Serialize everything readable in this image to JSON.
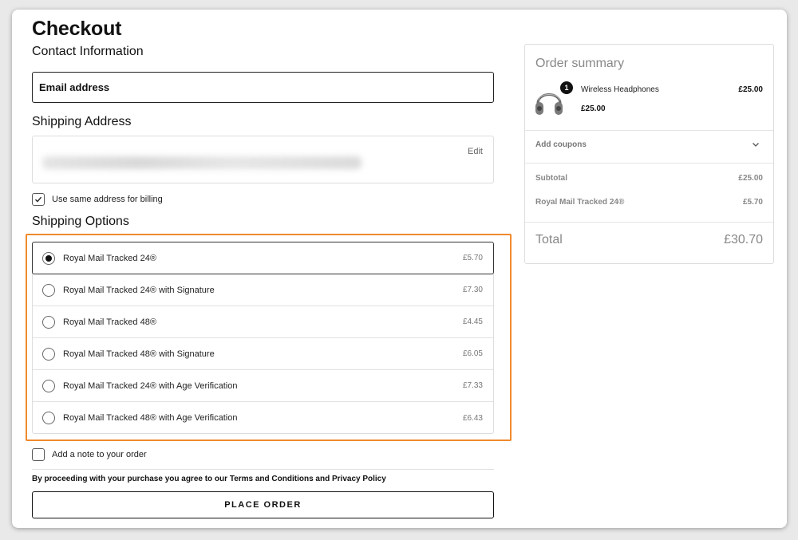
{
  "checkout": {
    "title": "Checkout",
    "contact_heading": "Contact Information",
    "email_placeholder": "Email address",
    "shipping_address_heading": "Shipping Address",
    "edit_label": "Edit",
    "same_billing_label": "Use same address for billing",
    "same_billing_checked": true,
    "shipping_options_heading": "Shipping Options",
    "shipping_options": [
      {
        "label": "Royal Mail Tracked 24®",
        "price": "£5.70",
        "selected": true
      },
      {
        "label": "Royal Mail Tracked 24® with Signature",
        "price": "£7.30",
        "selected": false
      },
      {
        "label": "Royal Mail Tracked 48®",
        "price": "£4.45",
        "selected": false
      },
      {
        "label": "Royal Mail Tracked 48® with Signature",
        "price": "£6.05",
        "selected": false
      },
      {
        "label": "Royal Mail Tracked 24® with Age Verification",
        "price": "£7.33",
        "selected": false
      },
      {
        "label": "Royal Mail Tracked 48® with Age Verification",
        "price": "£6.43",
        "selected": false
      }
    ],
    "note_label": "Add a note to your order",
    "note_checked": false,
    "terms_text": "By proceeding with your purchase you agree to our Terms and Conditions and Privacy Policy",
    "place_order_label": "PLACE ORDER"
  },
  "summary": {
    "title": "Order summary",
    "item": {
      "name": "Wireless Headphones",
      "quantity": "1",
      "unit_price": "£25.00",
      "line_price": "£25.00",
      "icon": "headphones-icon"
    },
    "coupons_label": "Add coupons",
    "subtotal_label": "Subtotal",
    "subtotal_value": "£25.00",
    "shipping_label": "Royal Mail Tracked 24®",
    "shipping_value": "£5.70",
    "total_label": "Total",
    "total_value": "£30.70"
  },
  "colors": {
    "highlight": "#f08a2c",
    "text": "#111111",
    "muted": "#888888"
  }
}
